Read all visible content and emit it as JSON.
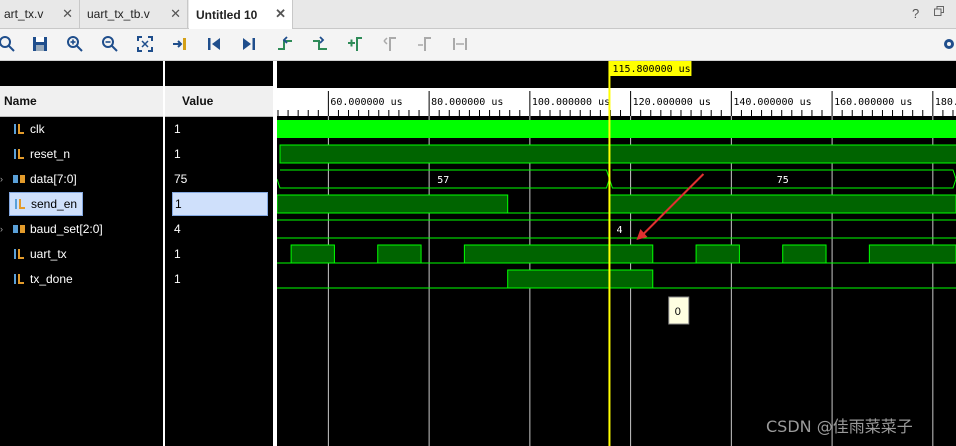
{
  "tabs": [
    {
      "label": "art_tx.v",
      "active": false
    },
    {
      "label": "uart_tx_tb.v",
      "active": false
    },
    {
      "label": "Untitled 10",
      "active": true
    }
  ],
  "window_controls": {
    "help": "?"
  },
  "toolbar_icons": [
    "search-icon",
    "save-icon",
    "zoom-in-icon",
    "zoom-out-icon",
    "zoom-fit-icon",
    "go-to-cursor-icon",
    "go-to-start-icon",
    "go-to-end-icon",
    "previous-transition-icon",
    "next-transition-icon",
    "add-marker-icon",
    "previous-marker-icon",
    "next-marker-icon",
    "swap-cursors-icon",
    "settings-icon"
  ],
  "columns": {
    "name": "Name",
    "value": "Value"
  },
  "signals": [
    {
      "name": "clk",
      "value": "1",
      "icon": "bit-signal-icon",
      "bus": false
    },
    {
      "name": "reset_n",
      "value": "1",
      "icon": "bit-signal-icon",
      "bus": false
    },
    {
      "name": "data[7:0]",
      "value": "75",
      "icon": "bus-signal-icon",
      "bus": true
    },
    {
      "name": "send_en",
      "value": "1",
      "icon": "bit-signal-icon",
      "bus": false,
      "selected": true
    },
    {
      "name": "baud_set[2:0]",
      "value": "4",
      "icon": "bus-signal-icon",
      "bus": true
    },
    {
      "name": "uart_tx",
      "value": "1",
      "icon": "bit-signal-icon",
      "bus": false
    },
    {
      "name": "tx_done",
      "value": "1",
      "icon": "bit-signal-icon",
      "bus": false
    }
  ],
  "cursor": {
    "label": "115.800000 us",
    "time_us": 115.8
  },
  "time_axis": {
    "start_us": 49.8,
    "end_us": 184.6,
    "major_ticks": [
      {
        "us": 60,
        "label": "60.000000 us"
      },
      {
        "us": 80,
        "label": "80.000000 us"
      },
      {
        "us": 100,
        "label": "100.000000 us"
      },
      {
        "us": 120,
        "label": "120.000000 us"
      },
      {
        "us": 140,
        "label": "140.000000 us"
      },
      {
        "us": 160,
        "label": "160.000000 us"
      },
      {
        "us": 180,
        "label": "180."
      }
    ]
  },
  "waveforms": {
    "data_values": [
      {
        "from_us": 49.8,
        "to_us": 115.8,
        "label": "57"
      },
      {
        "from_us": 115.8,
        "to_us": 184.6,
        "label": "75"
      }
    ],
    "baud_set_label": "4",
    "send_en_high": [
      [
        49.8,
        95.6
      ],
      [
        115.8,
        184.6
      ]
    ],
    "tx_done_high": [
      [
        95.6,
        124.4
      ]
    ],
    "uart_tx_high": [
      [
        52.6,
        61.2
      ],
      [
        69.8,
        78.4
      ],
      [
        87.0,
        124.4
      ],
      [
        133.0,
        141.6
      ],
      [
        150.2,
        158.8
      ],
      [
        167.4,
        184.6
      ]
    ]
  },
  "tooltip": {
    "text": "0"
  },
  "watermark": "CSDN @佳雨菜菜子",
  "colors": {
    "wave_green": "#00ff00",
    "wave_dark_green": "#006400",
    "cursor": "#ffff00",
    "arrow": "#e03030",
    "grid": "#c8c8c8"
  }
}
